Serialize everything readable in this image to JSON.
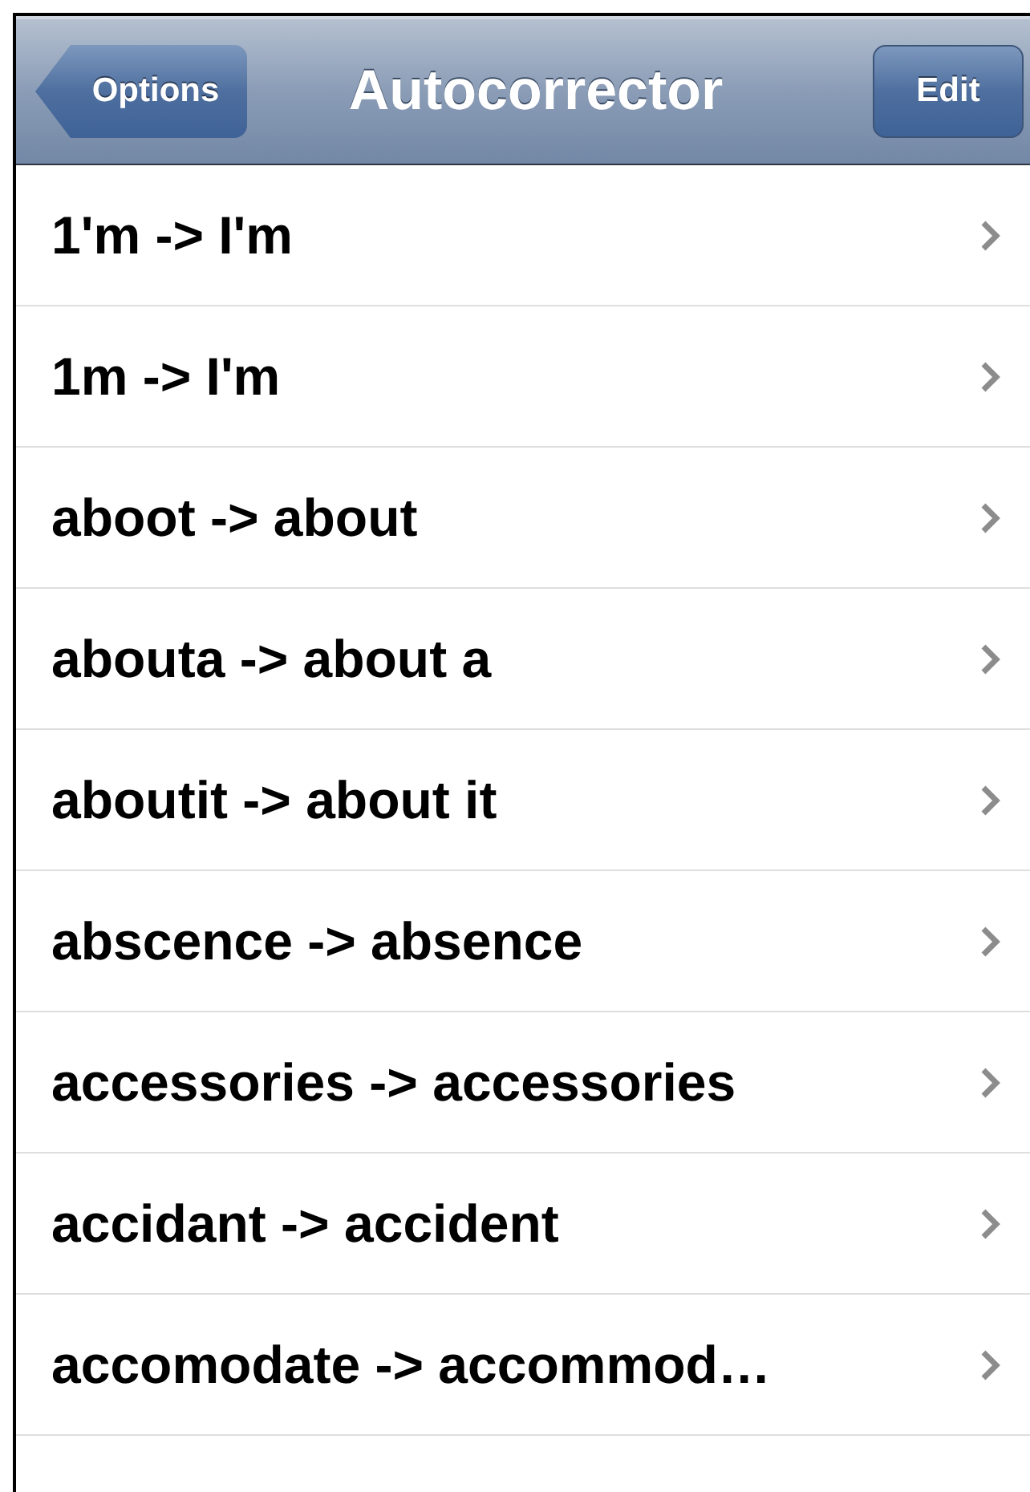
{
  "nav_bar": {
    "back_button": "Options",
    "title": "Autocorrector",
    "edit_button": "Edit"
  },
  "rows": [
    {
      "label": "1'm -> I'm"
    },
    {
      "label": "1m -> I'm"
    },
    {
      "label": "aboot -> about"
    },
    {
      "label": "abouta -> about a"
    },
    {
      "label": "aboutit -> about it"
    },
    {
      "label": "abscence -> absence"
    },
    {
      "label": "accessories -> accessories"
    },
    {
      "label": "accidant -> accident"
    },
    {
      "label": "accomodate -> accommod…"
    }
  ]
}
